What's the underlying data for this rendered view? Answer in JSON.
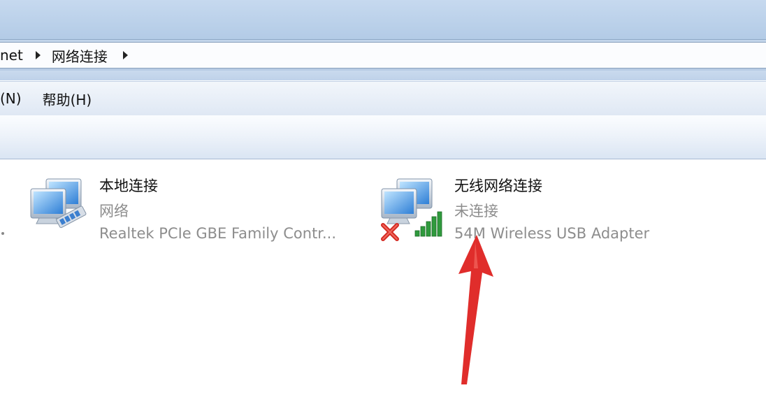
{
  "breadcrumb": {
    "items": [
      "net",
      "网络连接"
    ]
  },
  "menu": {
    "items": [
      "(N)",
      "帮助(H)"
    ]
  },
  "connections": [
    {
      "name": "本地连接",
      "status": "网络",
      "adapter": "Realtek PCIe GBE Family Contr..."
    },
    {
      "name": "无线网络连接",
      "status": "未连接",
      "adapter": "54M Wireless USB Adapter"
    }
  ],
  "colors": {
    "annotation_arrow": "#e02d2b",
    "disconnected_x": "#d42a22",
    "signal_bars": "#2f9a3d"
  }
}
